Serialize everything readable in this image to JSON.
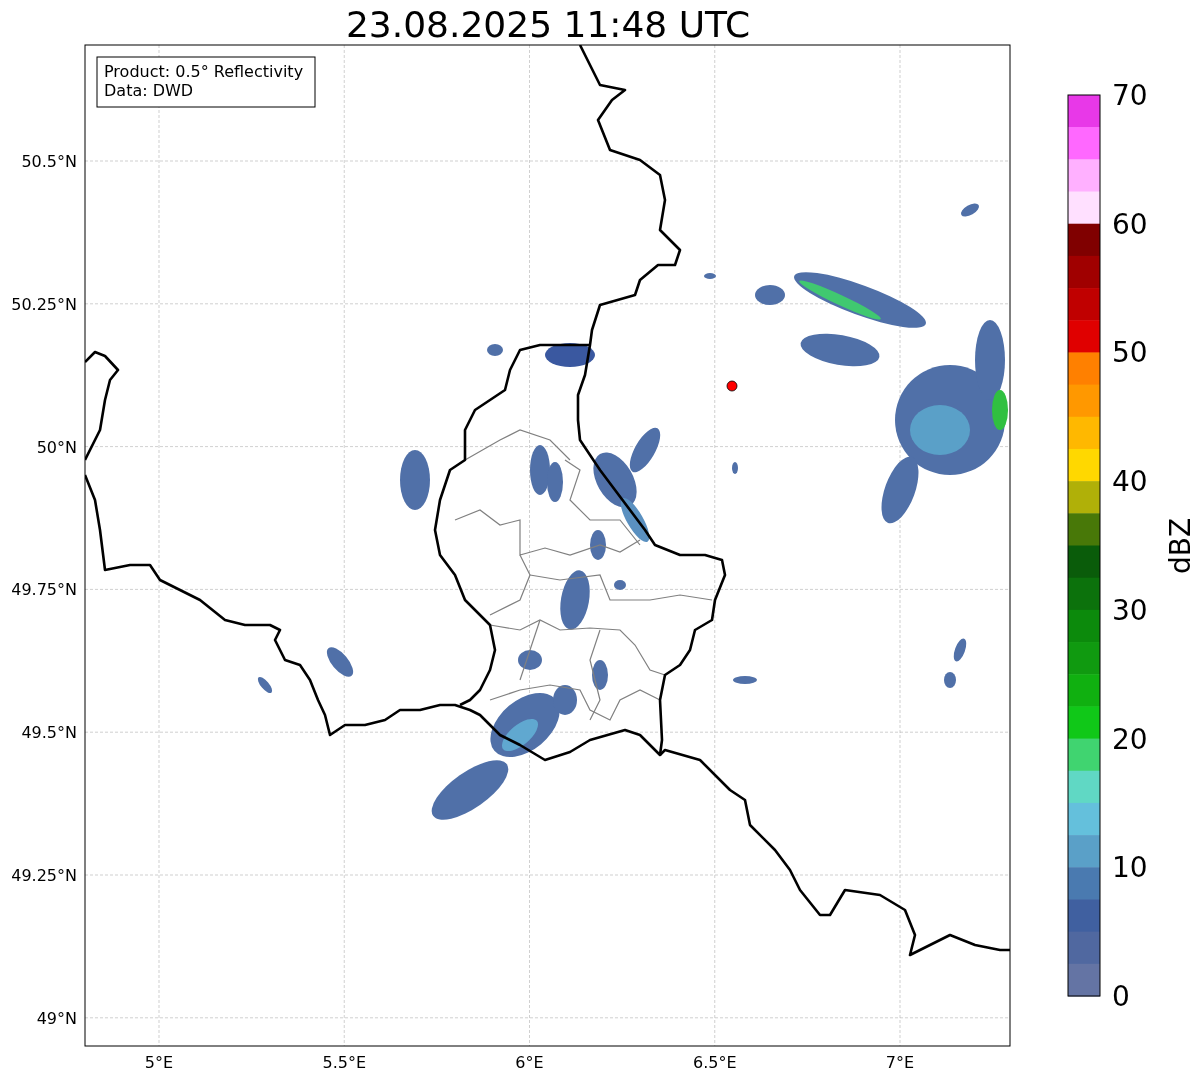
{
  "title": "23.08.2025 11:48 UTC",
  "info_box": [
    "Product: 0.5° Reflectivity",
    "Data: DWD"
  ],
  "map": {
    "y_ticks": [
      "50.5°N",
      "50.25°N",
      "50°N",
      "49.75°N",
      "49.5°N",
      "49.25°N",
      "49°N"
    ],
    "x_ticks": [
      "5°E",
      "5.5°E",
      "6°E",
      "6.5°E",
      "7°E"
    ]
  },
  "colorbar": {
    "label": "dBZ",
    "ticks": [
      "70",
      "60",
      "50",
      "40",
      "30",
      "20",
      "10",
      "0"
    ],
    "bands": [
      {
        "color": "#e838e8"
      },
      {
        "color": "#ff68ff"
      },
      {
        "color": "#ffb0ff"
      },
      {
        "color": "#ffe0ff"
      },
      {
        "color": "#800000"
      },
      {
        "color": "#a00000"
      },
      {
        "color": "#c00000"
      },
      {
        "color": "#e00000"
      },
      {
        "color": "#ff8000"
      },
      {
        "color": "#ff9800"
      },
      {
        "color": "#ffb800"
      },
      {
        "color": "#ffd800"
      },
      {
        "color": "#b0b008"
      },
      {
        "color": "#487808"
      },
      {
        "color": "#0a5c0a"
      },
      {
        "color": "#0c720c"
      },
      {
        "color": "#0c8a0c"
      },
      {
        "color": "#109a10"
      },
      {
        "color": "#10b010"
      },
      {
        "color": "#10c818"
      },
      {
        "color": "#40d470"
      },
      {
        "color": "#60d8c4"
      },
      {
        "color": "#64c0dc"
      },
      {
        "color": "#5aa0c8"
      },
      {
        "color": "#4a7ab0"
      },
      {
        "color": "#4060a0"
      },
      {
        "color": "#5068a0"
      },
      {
        "color": "#6474a4"
      }
    ]
  }
}
